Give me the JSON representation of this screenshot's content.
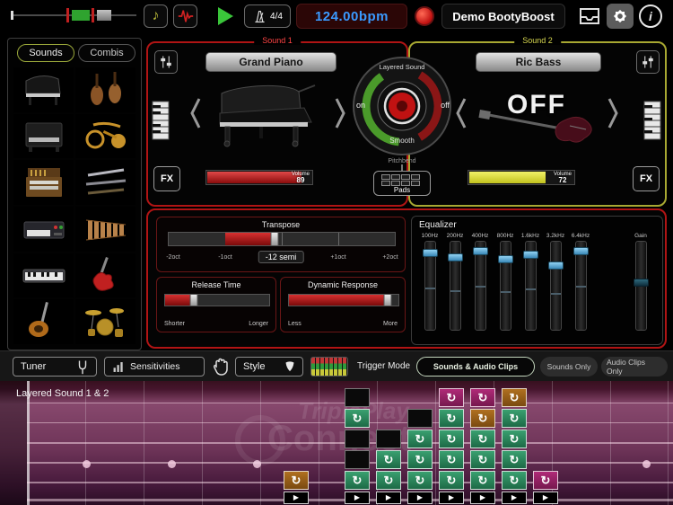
{
  "colors": {
    "accent_red": "#b01414",
    "accent_yellow": "#a8a832",
    "bpm_blue": "#3a9aff",
    "eq_blue": "#5aaad8",
    "cell_green": "#2e8a5e",
    "cell_orange": "#99601a",
    "cell_magenta": "#99206a"
  },
  "topbar": {
    "time_sig": "4/4",
    "bpm": "124.00bpm",
    "preset": "Demo BootyBoost"
  },
  "sidebar": {
    "tabs": [
      {
        "label": "Sounds",
        "active": true
      },
      {
        "label": "Combis",
        "active": false
      }
    ],
    "instruments": [
      "grand-piano",
      "orchestra-strings",
      "clavinet",
      "brass",
      "organ",
      "woodwinds",
      "synth-keyboard",
      "marimba",
      "stage-keyboard",
      "electric-guitar",
      "bass-guitar",
      "drum-kit"
    ]
  },
  "sound1": {
    "panel_label": "Sound 1",
    "name": "Grand Piano",
    "fx": "FX",
    "volume_label": "Volume",
    "volume_value": "89"
  },
  "sound2": {
    "panel_label": "Sound 2",
    "name": "Ric Bass",
    "state": "OFF",
    "fx": "FX",
    "volume_label": "Volume",
    "volume_value": "72"
  },
  "layer_control": {
    "title": "Layered Sound",
    "on": "on",
    "off": "off",
    "mode": "Smooth",
    "pitchbend": "Pitchbend",
    "pads": "Pads"
  },
  "transpose": {
    "title": "Transpose",
    "labels": [
      "-2oct",
      "-1oct",
      "-12 semi",
      "+1oct",
      "+2oct"
    ],
    "selected": "-12 semi",
    "fill_start_pct": 25,
    "fill_end_pct": 47
  },
  "release_time": {
    "title": "Release Time",
    "min": "Shorter",
    "max": "Longer",
    "value_pct": 28
  },
  "dynamic_response": {
    "title": "Dynamic Response",
    "min": "Less",
    "max": "More",
    "value_pct": 90
  },
  "equalizer": {
    "title": "Equalizer",
    "bands": [
      {
        "label": "100Hz",
        "pos_pct": 8,
        "tick_pct": 52
      },
      {
        "label": "200Hz",
        "pos_pct": 13,
        "tick_pct": 55
      },
      {
        "label": "400Hz",
        "pos_pct": 6,
        "tick_pct": 50
      },
      {
        "label": "800Hz",
        "pos_pct": 15,
        "tick_pct": 56
      },
      {
        "label": "1.6kHz",
        "pos_pct": 10,
        "tick_pct": 53
      },
      {
        "label": "3.2kHz",
        "pos_pct": 22,
        "tick_pct": 58
      },
      {
        "label": "6.4kHz",
        "pos_pct": 6,
        "tick_pct": 50
      }
    ],
    "gain": {
      "label": "Gain",
      "pos_pct": 42
    }
  },
  "toolbar": {
    "tuner": "Tuner",
    "sensitivities": "Sensitivities",
    "style": "Style",
    "trigger_mode_label": "Trigger Mode",
    "modes": [
      {
        "label": "Sounds & Audio Clips",
        "active": true
      },
      {
        "label": "Sounds Only",
        "active": false
      },
      {
        "label": "Audio Clips Only",
        "active": false
      }
    ]
  },
  "fretboard": {
    "title": "Layered Sound 1 & 2",
    "watermark": [
      "TriplePlay",
      "Connect"
    ],
    "columns": [
      {
        "cells": [
          "",
          "",
          "",
          "",
          "orange"
        ]
      },
      {
        "cells": [
          "empty",
          "green",
          "empty",
          "empty",
          "green"
        ]
      },
      {
        "cells": [
          "",
          "",
          "empty",
          "green",
          "green"
        ]
      },
      {
        "cells": [
          "",
          "empty",
          "green",
          "green",
          "green"
        ]
      },
      {
        "cells": [
          "magenta",
          "green",
          "green",
          "green",
          "green"
        ]
      },
      {
        "cells": [
          "magenta",
          "orange",
          "green",
          "green",
          "green"
        ]
      },
      {
        "cells": [
          "orange",
          "green",
          "green",
          "green",
          "green"
        ]
      },
      {
        "cells": [
          "",
          "",
          "",
          "",
          "magenta"
        ]
      }
    ]
  }
}
